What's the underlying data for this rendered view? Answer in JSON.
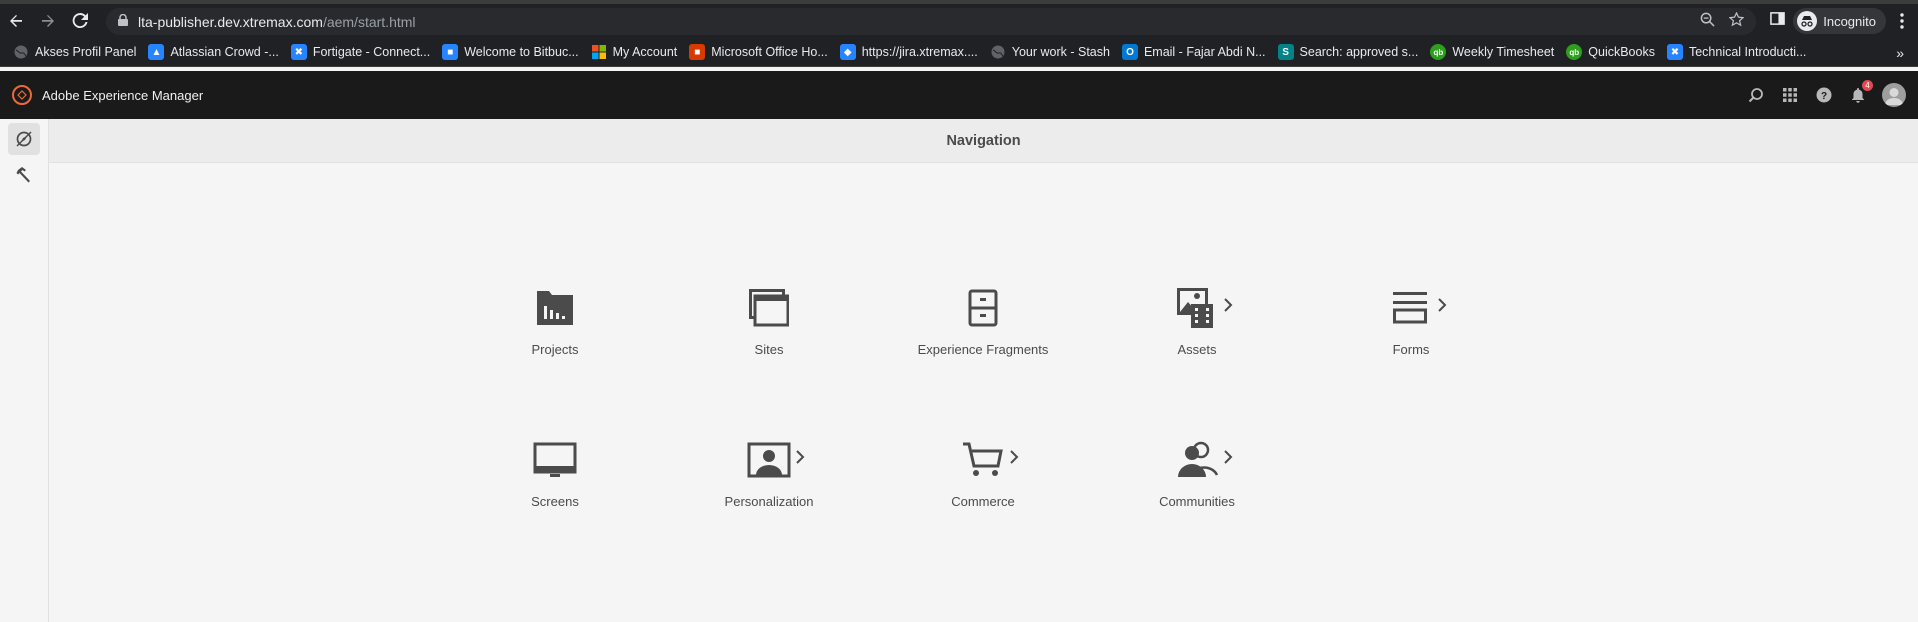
{
  "browser": {
    "url_host": "lta-publisher.dev.xtremax.com",
    "url_path": "/aem/start.html",
    "profile_label": "Incognito"
  },
  "bookmarks": [
    {
      "label": "Akses Profil Panel",
      "icon": "globe-icon",
      "color": "#5f6368"
    },
    {
      "label": "Atlassian Crowd -...",
      "icon": "atlassian-icon",
      "color": "#2684ff"
    },
    {
      "label": "Fortigate - Connect...",
      "icon": "confluence-icon",
      "color": "#2684ff"
    },
    {
      "label": "Welcome to Bitbuc...",
      "icon": "bitbucket-icon",
      "color": "#2684ff"
    },
    {
      "label": "My Account",
      "icon": "microsoft-icon",
      "color": "#f25022"
    },
    {
      "label": "Microsoft Office Ho...",
      "icon": "office-icon",
      "color": "#d83b01"
    },
    {
      "label": "https://jira.xtremax....",
      "icon": "jira-icon",
      "color": "#2684ff"
    },
    {
      "label": "Your work - Stash",
      "icon": "globe-icon",
      "color": "#5f6368"
    },
    {
      "label": "Email - Fajar Abdi N...",
      "icon": "outlook-icon",
      "color": "#0078d4"
    },
    {
      "label": "Search: approved s...",
      "icon": "sharepoint-icon",
      "color": "#038387"
    },
    {
      "label": "Weekly Timesheet",
      "icon": "quickbooks-icon",
      "color": "#2ca01c"
    },
    {
      "label": "QuickBooks",
      "icon": "quickbooks-icon",
      "color": "#2ca01c"
    },
    {
      "label": "Technical Introducti...",
      "icon": "confluence-icon",
      "color": "#2684ff"
    }
  ],
  "aem": {
    "title": "Adobe Experience Manager",
    "notification_count": "4",
    "nav_title": "Navigation"
  },
  "tiles": [
    {
      "label": "Projects",
      "icon": "projects-icon",
      "has_chevron": false
    },
    {
      "label": "Sites",
      "icon": "sites-icon",
      "has_chevron": false
    },
    {
      "label": "Experience Fragments",
      "icon": "experience-fragments-icon",
      "has_chevron": false
    },
    {
      "label": "Assets",
      "icon": "assets-icon",
      "has_chevron": true
    },
    {
      "label": "Forms",
      "icon": "forms-icon",
      "has_chevron": true
    },
    {
      "label": "Screens",
      "icon": "screens-icon",
      "has_chevron": false
    },
    {
      "label": "Personalization",
      "icon": "personalization-icon",
      "has_chevron": true
    },
    {
      "label": "Commerce",
      "icon": "commerce-icon",
      "has_chevron": true
    },
    {
      "label": "Communities",
      "icon": "communities-icon",
      "has_chevron": true
    }
  ]
}
